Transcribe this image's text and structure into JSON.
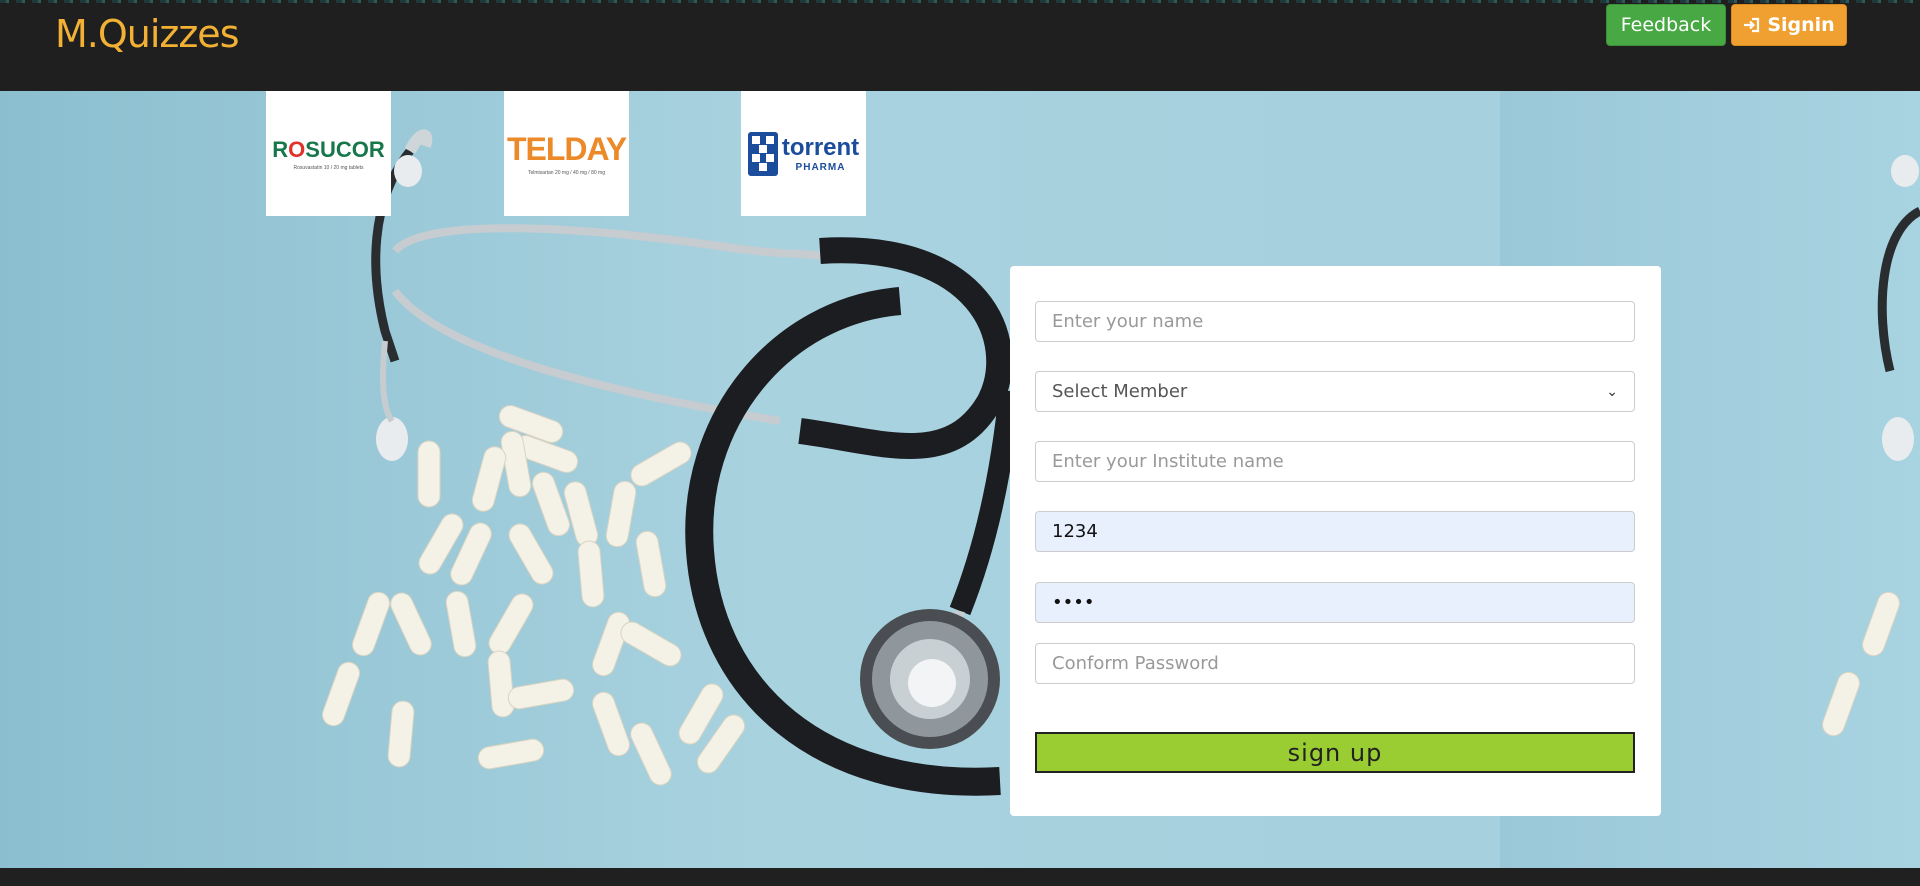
{
  "header": {
    "brand": "M.Quizzes",
    "feedback_label": "Feedback",
    "signin_label": "Signin",
    "signin_icon": "sign-in-icon"
  },
  "logos": [
    {
      "name": "ROSUCOR",
      "sub": "Rosuvastatin 10 / 20 mg tablets"
    },
    {
      "name": "TELDAY",
      "sub": "Telmisartan 20 mg / 40 mg / 80 mg"
    },
    {
      "name": "torrent",
      "sub": "PHARMA"
    }
  ],
  "form": {
    "name_placeholder": "Enter your name",
    "member_selected": "Select Member",
    "institute_placeholder": "Enter your Institute name",
    "code_value": "1234",
    "password_value": "••••",
    "confirm_placeholder": "Conform Password",
    "submit_label": "sign up"
  },
  "colors": {
    "brand": "#f2b134",
    "feedback": "#48a843",
    "signin": "#f0a030",
    "signup": "#9acd32"
  }
}
